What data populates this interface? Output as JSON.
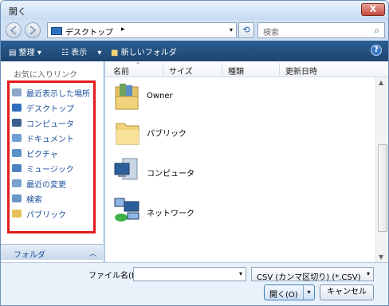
{
  "window": {
    "title": "開く",
    "close_label": "X"
  },
  "address": {
    "path": "デスクトップ",
    "separator": "▸",
    "dropdown": "▾"
  },
  "search": {
    "placeholder": "検索"
  },
  "toolbar": {
    "organize": "整理",
    "view": "表示",
    "new_folder": "新しいフォルダ",
    "dropdown": "▾",
    "help": "?"
  },
  "left": {
    "header": "お気に入りリンク",
    "links": [
      {
        "label": "最近表示した場所",
        "icon": "recent-places-icon",
        "color": "#8aa6c8"
      },
      {
        "label": "デスクトップ",
        "icon": "desktop-icon",
        "color": "#2e6fbf"
      },
      {
        "label": "コンピュータ",
        "icon": "computer-icon",
        "color": "#3a5f8d"
      },
      {
        "label": "ドキュメント",
        "icon": "documents-icon",
        "color": "#6ea0d6"
      },
      {
        "label": "ピクチャ",
        "icon": "pictures-icon",
        "color": "#5b91c9"
      },
      {
        "label": "ミュージック",
        "icon": "music-icon",
        "color": "#4c82c0"
      },
      {
        "label": "最近の変更",
        "icon": "recently-changed-icon",
        "color": "#7aa0cf"
      },
      {
        "label": "検索",
        "icon": "search-folder-icon",
        "color": "#6b96c9"
      },
      {
        "label": "パブリック",
        "icon": "public-folder-icon",
        "color": "#e4c15a"
      }
    ],
    "folders_label": "フォルダ",
    "folders_chevron": "︿"
  },
  "columns": {
    "name": "名前",
    "sort_arrow": "^",
    "size": "サイズ",
    "type": "種類",
    "modified": "更新日時"
  },
  "items": [
    {
      "label": "Owner",
      "icon": "user-folder-icon"
    },
    {
      "label": "パブリック",
      "icon": "folder-icon"
    },
    {
      "label": "コンピュータ",
      "icon": "computer-icon"
    },
    {
      "label": "ネットワーク",
      "icon": "network-icon"
    }
  ],
  "bottom": {
    "filename_label": "ファイル名(N):",
    "filename_value": "",
    "filetype": "CSV (カンマ区切り) (*.CSV)",
    "open": "開く(O)",
    "cancel": "キャンセル"
  }
}
